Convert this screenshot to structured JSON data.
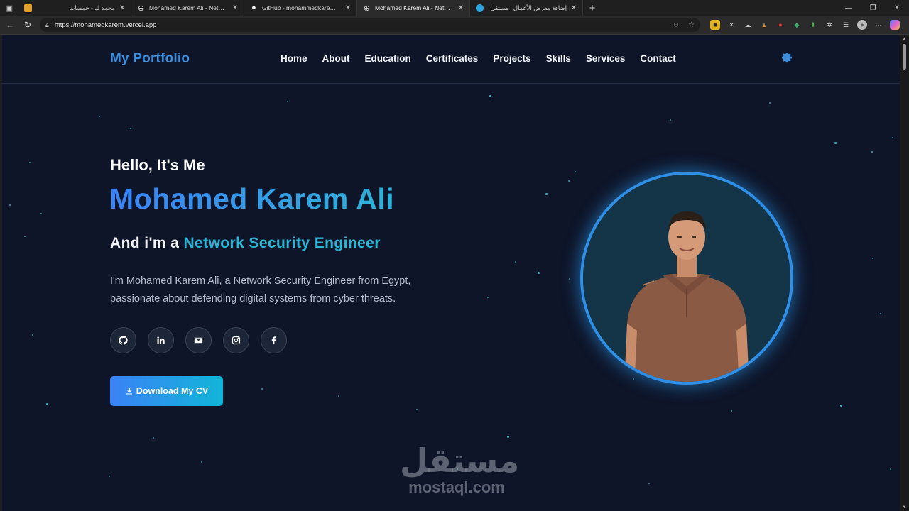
{
  "browser": {
    "tabs": [
      {
        "title": "محمد ك - خمسات",
        "rtl": true,
        "favicon": "khamsat-icon",
        "favicon_color": "#e0a02a",
        "active": false
      },
      {
        "title": "Mohamed Karem Ali - Network Se",
        "rtl": false,
        "favicon": "globe-icon",
        "active": false
      },
      {
        "title": "GitHub - mohammedkarem/portf",
        "rtl": false,
        "favicon": "github-icon",
        "active": false
      },
      {
        "title": "Mohamed Karem Ali - Network Se",
        "rtl": false,
        "favicon": "globe-icon",
        "active": true
      },
      {
        "title": "إضافة معرض الأعمال | مستقل",
        "rtl": true,
        "favicon": "mostaql-icon",
        "favicon_color": "#2aa6e0",
        "active": false
      }
    ],
    "url": "https://mohamedkarem.vercel.app"
  },
  "site": {
    "brand": "My Portfolio",
    "nav": [
      "Home",
      "About",
      "Education",
      "Certificates",
      "Projects",
      "Skills",
      "Services",
      "Contact"
    ],
    "accent": "#3a8ee0",
    "settings_icon": "gear-icon"
  },
  "hero": {
    "greeting": "Hello, It's Me",
    "name": "Mohamed Karem Ali",
    "role_prefix": "And i'm a",
    "role": "Network Security Engineer",
    "bio": "I'm Mohamed Karem Ali, a Network Security Engineer from Egypt, passionate about defending digital systems from cyber threats.",
    "socials": [
      "github-icon",
      "linkedin-icon",
      "email-icon",
      "instagram-icon",
      "facebook-icon"
    ],
    "cv_button": "Download My CV"
  },
  "watermark": {
    "arabic": "مستقل",
    "latin": "mostaql.com"
  }
}
